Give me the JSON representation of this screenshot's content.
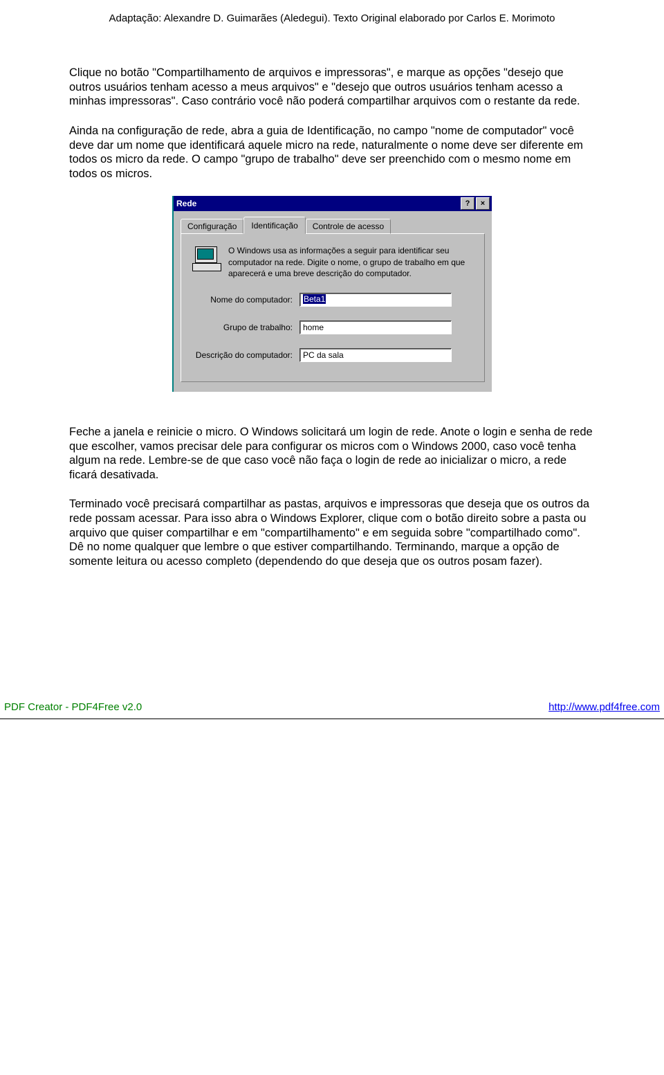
{
  "header": "Adaptação: Alexandre D. Guimarães (Aledegui). Texto Original elaborado por Carlos E. Morimoto",
  "para1": "Clique no botão \"Compartilhamento de arquivos e impressoras\", e marque as opções \"desejo que outros usuários tenham acesso a meus arquivos\" e \"desejo que outros usuários tenham acesso a minhas impressoras\". Caso contrário você não poderá compartilhar arquivos com o restante da rede.",
  "para2": "Ainda na configuração de rede, abra a guia de Identificação, no campo \"nome de computador\" você deve dar um nome que identificará aquele micro na rede, naturalmente o nome deve ser diferente em todos os micro da rede. O campo \"grupo de trabalho\" deve ser preenchido com o mesmo nome em todos os micros.",
  "dialog": {
    "title": "Rede",
    "help_symbol": "?",
    "close_symbol": "×",
    "tabs": {
      "t0": "Configuração",
      "t1": "Identificação",
      "t2": "Controle de acesso"
    },
    "info": "O Windows usa as informações a seguir para identificar seu computador na rede. Digite o nome, o grupo de trabalho em que aparecerá e uma breve descrição do computador.",
    "fields": {
      "name_label": "Nome do computador:",
      "name_value": "Beta1",
      "group_label": "Grupo de trabalho:",
      "group_value": "home",
      "desc_label": "Descrição do computador:",
      "desc_value": "PC da sala"
    }
  },
  "para3": "Feche a janela e reinicie o micro. O Windows solicitará um login de rede. Anote o login e senha de rede que escolher, vamos precisar dele para configurar os micros com o Windows 2000, caso você tenha algum na rede. Lembre-se de que caso você não faça o login de rede ao inicializar o micro, a rede ficará desativada.",
  "para4": "Terminado você precisará compartilhar as pastas, arquivos e impressoras que deseja que os outros da rede possam acessar. Para isso abra o Windows Explorer, clique com o botão direito sobre a pasta ou arquivo que quiser compartilhar e em \"compartilhamento\" e em seguida sobre \"compartilhado como\". Dê no nome qualquer que lembre o que estiver compartilhando. Terminando, marque a opção de somente leitura ou acesso completo (dependendo do que deseja que os outros posam fazer).",
  "footer": {
    "left": "PDF Creator - PDF4Free v2.0",
    "right": "http://www.pdf4free.com"
  }
}
